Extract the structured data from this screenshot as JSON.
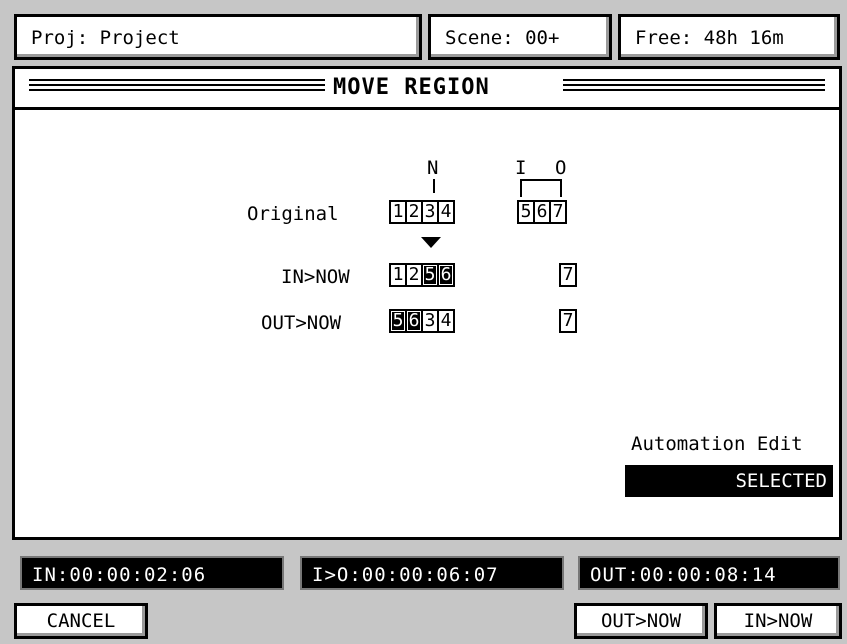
{
  "header": {
    "project": "Proj: Project",
    "scene": "Scene: 00+",
    "free": "Free: 48h 16m"
  },
  "dialog": {
    "title": "MOVE REGION",
    "markers": {
      "now": "N",
      "in": "I",
      "out": "O"
    },
    "rows": [
      {
        "label": "Original",
        "cells": [
          "1",
          "2",
          "3",
          "4"
        ],
        "extra": [
          "5",
          "6",
          "7"
        ]
      },
      {
        "label": "IN>NOW",
        "cells": [
          "1",
          "2",
          "5",
          "6"
        ],
        "extra": [
          "7"
        ]
      },
      {
        "label": "OUT>NOW",
        "cells": [
          "5",
          "6",
          "3",
          "4"
        ],
        "extra": [
          "7"
        ]
      }
    ],
    "automation_label": "Automation Edit",
    "automation_value": "SELECTED"
  },
  "times": {
    "in": "IN:00:00:02:06",
    "in_to_out": "I>O:00:00:06:07",
    "out": "OUT:00:00:08:14"
  },
  "buttons": {
    "cancel": "CANCEL",
    "out_now": "OUT>NOW",
    "in_now": "IN>NOW"
  },
  "colors": {
    "background": "#c6c6c6",
    "panel": "#ffffff",
    "ink": "#000000"
  }
}
